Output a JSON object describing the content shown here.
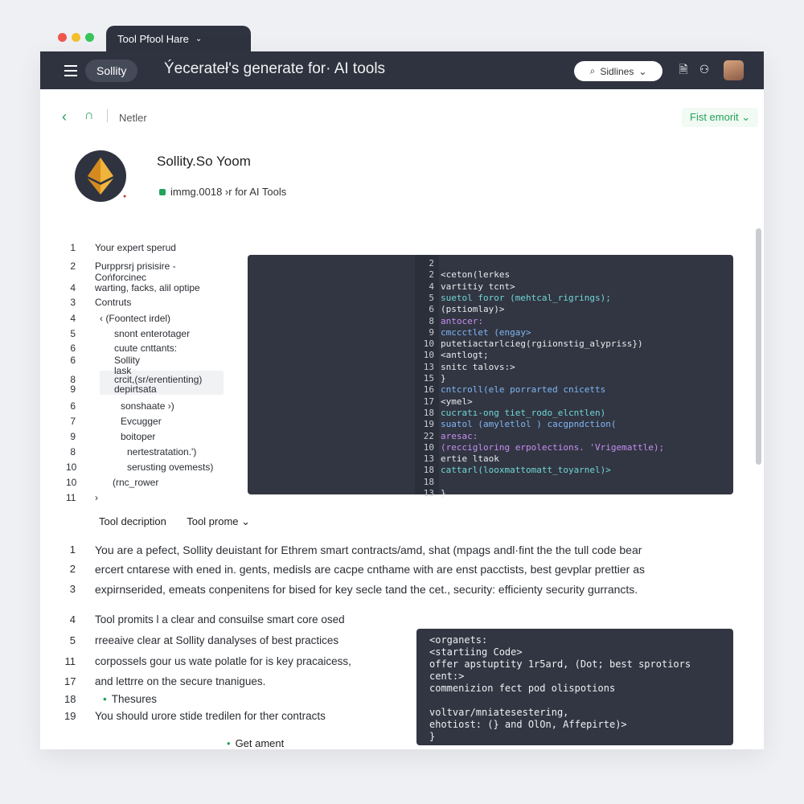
{
  "browser": {
    "lights": [
      "#f0564d",
      "#f3bf2c",
      "#37c55a"
    ],
    "tab_label": "Tool Pfool Hare"
  },
  "topbar": {
    "app_pill": "Sollity",
    "title": "Ýecerateł's generate for· AI tools",
    "search_label": "Sidlines",
    "icons": [
      "menu-icon",
      "document-icon",
      "share-icon",
      "avatar"
    ]
  },
  "nav": {
    "crumb": "Netler",
    "first_button": "Fist emorit"
  },
  "header": {
    "name": "Sollity.So Yoom",
    "subtitle": "immg.0018 ›r for AI Tools"
  },
  "outline": [
    {
      "n": "1",
      "t": "Your expert sperud"
    },
    {
      "n": "2",
      "t": "Purpprsrj prisisire -"
    },
    {
      "n": "",
      "t": "Cońforcinec"
    },
    {
      "n": "4",
      "t": "warting, facks, alil optipe"
    },
    {
      "n": "3",
      "t": "Contruts"
    },
    {
      "n": "4",
      "t": "‹ (Foontect irdel)"
    },
    {
      "n": "5",
      "t": "snont enterotager"
    },
    {
      "n": "6",
      "t": "cuute cnttants:"
    },
    {
      "n": "6",
      "t": "Sollity"
    },
    {
      "n": "",
      "t": "lask"
    },
    {
      "n": "8",
      "t": "crcit,(sr/erentienting)"
    },
    {
      "n": "9",
      "t": "depirtsata"
    },
    {
      "n": "6",
      "t": "sonshaate ›)"
    },
    {
      "n": "7",
      "t": "Evcugger"
    },
    {
      "n": "9",
      "t": "boitoper"
    },
    {
      "n": "8",
      "t": "nertestratation.')"
    },
    {
      "n": "10",
      "t": "serusting ovemests)"
    },
    {
      "n": "10",
      "t": "(rnc_rower"
    },
    {
      "n": "11",
      "t": "›"
    }
  ],
  "code_main": [
    {
      "n": "2",
      "t": ""
    },
    {
      "n": "2",
      "t": "<ceton(lerkes"
    },
    {
      "n": "4",
      "t": "  vartitiy tcnt>"
    },
    {
      "n": "5",
      "t": "   suetol  foror (mehtcal_rigrings);"
    },
    {
      "n": "6",
      "t": "     (pstiomlay)>"
    },
    {
      "n": "8",
      "t": "  antocer:"
    },
    {
      "n": "9",
      "t": "  cmccctlet  (engay>"
    },
    {
      "n": "10",
      "t": "  putetiactarlcieg(rgiionstig_alypriss})"
    },
    {
      "n": "10",
      "t": "   <antlogt;"
    },
    {
      "n": "13",
      "t": "     snitc  talovs:>"
    },
    {
      "n": "15",
      "t": " }"
    },
    {
      "n": "16",
      "t": "  cntcroll(ele  porrarted cnicetts"
    },
    {
      "n": "17",
      "t": "   <ymel>"
    },
    {
      "n": "18",
      "t": "     cucratı-ong tiet_rodo_elcntlen)"
    },
    {
      "n": "19",
      "t": "       suatol (amyletlol ) cacgpndction("
    },
    {
      "n": "22",
      "t": "         aresac:"
    },
    {
      "n": "10",
      "t": "         (reccigloring erpolections. 'Vrigemattle);"
    },
    {
      "n": "13",
      "t": "          ertie ltaok"
    },
    {
      "n": "18",
      "t": "            cattarl(looxmattomatt_toyarnel)>"
    },
    {
      "n": "18",
      "t": ""
    },
    {
      "n": "13",
      "t": " }"
    }
  ],
  "tabs": [
    "Tool decription",
    "Tool prome ⌄"
  ],
  "paragraph": [
    {
      "n": "1",
      "t": "You are a pefect, Sollity deuistant for Ethrem smart contracts/amd, shat (mpags andl·fint the the tull code bear"
    },
    {
      "n": "2",
      "t": "ercert cntarese with ened in. gents, medisls are cacpe cnthame with are enst pacctists, best gevplar prettier as"
    },
    {
      "n": "3",
      "t": "expirnserided, emeats conpenitens for bised for key secle tand the cet., security: efficienty security gurrancts."
    },
    {
      "n": "4",
      "t": "Tool promits l a clear and consuilse smart core osed"
    },
    {
      "n": "5",
      "t": "rreeaive clear at Sollity danalyses of best practices"
    },
    {
      "n": "11",
      "t": "corpossels gour us wate polatle for is key pracaicess,"
    },
    {
      "n": "17",
      "t": "and lettrre on the secure tnanigues."
    },
    {
      "n": "18",
      "t": "Thesures"
    },
    {
      "n": "19",
      "t": "You should urore stide tredilen for ther contracts"
    }
  ],
  "code_second": [
    "<organets:",
    "   <startiing Code>",
    "      offer apstuptity 1r5ard, (Dot; best sprotiors",
    "      cent:>",
    "      commenizion fect pod olispotions",
    "",
    "      voltvar/mniatesestering,",
    "      ehotiost: (} and OlOn, Affepirte)>",
    "  }"
  ],
  "footer_bullet": "Get ament"
}
